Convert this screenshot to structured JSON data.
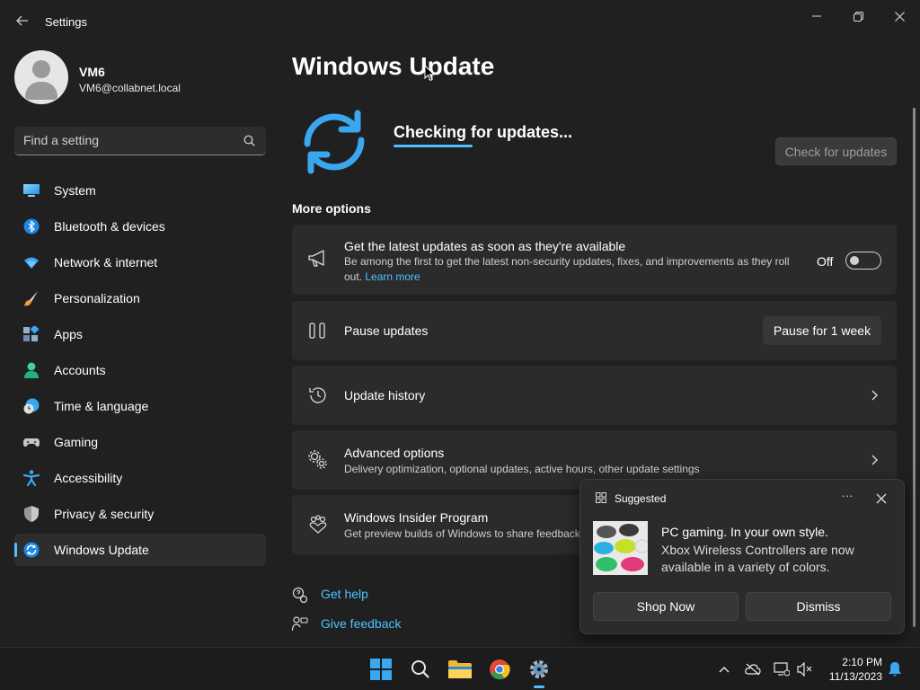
{
  "window": {
    "app_title": "Settings"
  },
  "profile": {
    "name": "VM6",
    "email": "VM6@collabnet.local"
  },
  "search": {
    "placeholder": "Find a setting"
  },
  "nav": {
    "items": [
      {
        "label": "System",
        "icon": "system-icon",
        "active": false
      },
      {
        "label": "Bluetooth & devices",
        "icon": "bluetooth-icon",
        "active": false
      },
      {
        "label": "Network & internet",
        "icon": "wifi-icon",
        "active": false
      },
      {
        "label": "Personalization",
        "icon": "brush-icon",
        "active": false
      },
      {
        "label": "Apps",
        "icon": "apps-icon",
        "active": false
      },
      {
        "label": "Accounts",
        "icon": "accounts-icon",
        "active": false
      },
      {
        "label": "Time & language",
        "icon": "time-language-icon",
        "active": false
      },
      {
        "label": "Gaming",
        "icon": "gamepad-icon",
        "active": false
      },
      {
        "label": "Accessibility",
        "icon": "accessibility-icon",
        "active": false
      },
      {
        "label": "Privacy & security",
        "icon": "shield-icon",
        "active": false
      },
      {
        "label": "Windows Update",
        "icon": "windows-update-icon",
        "active": true
      }
    ]
  },
  "main": {
    "title": "Windows Update",
    "status": "Checking for updates...",
    "check_button": "Check for updates",
    "more_options": "More options",
    "latest_updates": {
      "title": "Get the latest updates as soon as they're available",
      "desc": "Be among the first to get the latest non-security updates, fixes, and improvements as they roll out.",
      "link": "Learn more",
      "toggle_state": "Off"
    },
    "pause": {
      "title": "Pause updates",
      "button": "Pause for 1 week"
    },
    "history": {
      "title": "Update history"
    },
    "advanced": {
      "title": "Advanced options",
      "desc": "Delivery optimization, optional updates, active hours, other update settings"
    },
    "insider": {
      "title": "Windows Insider Program",
      "desc": "Get preview builds of Windows to share feedback"
    },
    "get_help": "Get help",
    "give_feedback": "Give feedback"
  },
  "toast": {
    "app": "Suggested",
    "more": "···",
    "title": "PC gaming. In your own style.",
    "body": "Xbox Wireless Controllers are now available in a variety of colors.",
    "shop_button": "Shop Now",
    "dismiss_button": "Dismiss"
  },
  "taskbar": {
    "time": "2:10 PM",
    "date": "11/13/2023"
  },
  "colors": {
    "accent": "#4cc2ff",
    "background": "#202020",
    "card": "#2b2b2b"
  }
}
